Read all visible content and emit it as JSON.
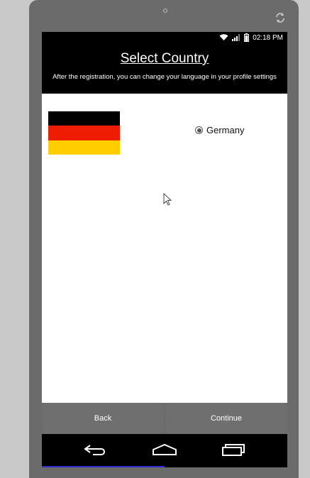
{
  "status": {
    "time": "02:18 PM"
  },
  "header": {
    "title": "Select Country",
    "subtitle": "After the registration, you can change your language in your profile settings"
  },
  "country": {
    "label": "Germany",
    "selected": true
  },
  "buttons": {
    "back": "Back",
    "continue": "Continue"
  },
  "colors": {
    "flag_black": "#000000",
    "flag_red": "#ee1c00",
    "flag_gold": "#ffcd00",
    "device": "#6b6b6b"
  },
  "icons": [
    "rotate-icon",
    "wifi-icon",
    "signal-icon",
    "battery-icon",
    "back-icon",
    "home-icon",
    "recents-icon"
  ]
}
